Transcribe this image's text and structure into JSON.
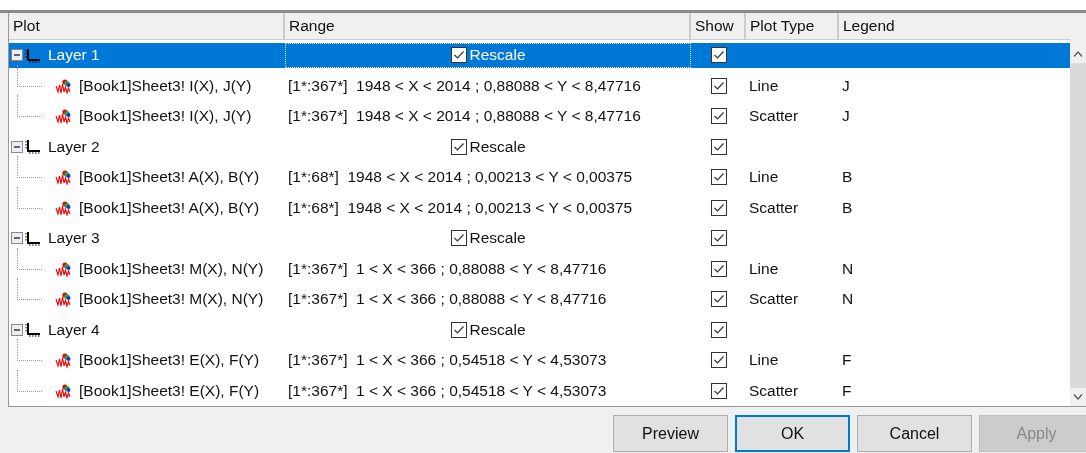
{
  "table": {
    "columns": [
      "Plot",
      "Range",
      "Show",
      "Plot Type",
      "Legend"
    ],
    "layers": [
      {
        "label": "Layer 1",
        "expanded": true,
        "selected": true,
        "rescale": {
          "label": "Rescale",
          "checked": true
        },
        "show": true,
        "children": [
          {
            "name": "[Book1]Sheet3! I(X), J(Y)",
            "range": "[1*:367*]  1948 < X < 2014 ; 0,88088 < Y < 8,47716",
            "show": true,
            "plot_type": "Line",
            "legend": "J"
          },
          {
            "name": "[Book1]Sheet3! I(X), J(Y)",
            "range": "[1*:367*]  1948 < X < 2014 ; 0,88088 < Y < 8,47716",
            "show": true,
            "plot_type": "Scatter",
            "legend": "J"
          }
        ]
      },
      {
        "label": "Layer 2",
        "expanded": true,
        "selected": false,
        "rescale": {
          "label": "Rescale",
          "checked": true
        },
        "show": true,
        "children": [
          {
            "name": "[Book1]Sheet3! A(X), B(Y)",
            "range": "[1*:68*]  1948 < X < 2014 ; 0,00213 < Y < 0,00375",
            "show": true,
            "plot_type": "Line",
            "legend": "B"
          },
          {
            "name": "[Book1]Sheet3! A(X), B(Y)",
            "range": "[1*:68*]  1948 < X < 2014 ; 0,00213 < Y < 0,00375",
            "show": true,
            "plot_type": "Scatter",
            "legend": "B"
          }
        ]
      },
      {
        "label": "Layer 3",
        "expanded": true,
        "selected": false,
        "rescale": {
          "label": "Rescale",
          "checked": true
        },
        "show": true,
        "children": [
          {
            "name": "[Book1]Sheet3! M(X), N(Y)",
            "range": "[1*:367*]  1 < X < 366 ; 0,88088 < Y < 8,47716",
            "show": true,
            "plot_type": "Line",
            "legend": "N"
          },
          {
            "name": "[Book1]Sheet3! M(X), N(Y)",
            "range": "[1*:367*]  1 < X < 366 ; 0,88088 < Y < 8,47716",
            "show": true,
            "plot_type": "Scatter",
            "legend": "N"
          }
        ]
      },
      {
        "label": "Layer 4",
        "expanded": true,
        "selected": false,
        "rescale": {
          "label": "Rescale",
          "checked": true
        },
        "show": true,
        "children": [
          {
            "name": "[Book1]Sheet3! E(X), F(Y)",
            "range": "[1*:367*]  1 < X < 366 ; 0,54518 < Y < 4,53073",
            "show": true,
            "plot_type": "Line",
            "legend": "F"
          },
          {
            "name": "[Book1]Sheet3! E(X), F(Y)",
            "range": "[1*:367*]  1 < X < 366 ; 0,54518 < Y < 4,53073",
            "show": true,
            "plot_type": "Scatter",
            "legend": "F"
          }
        ]
      }
    ]
  },
  "buttons": [
    {
      "label": "Preview",
      "kind": "normal"
    },
    {
      "label": "OK",
      "kind": "default"
    },
    {
      "label": "Cancel",
      "kind": "normal"
    },
    {
      "label": "Apply",
      "kind": "disabled"
    }
  ]
}
